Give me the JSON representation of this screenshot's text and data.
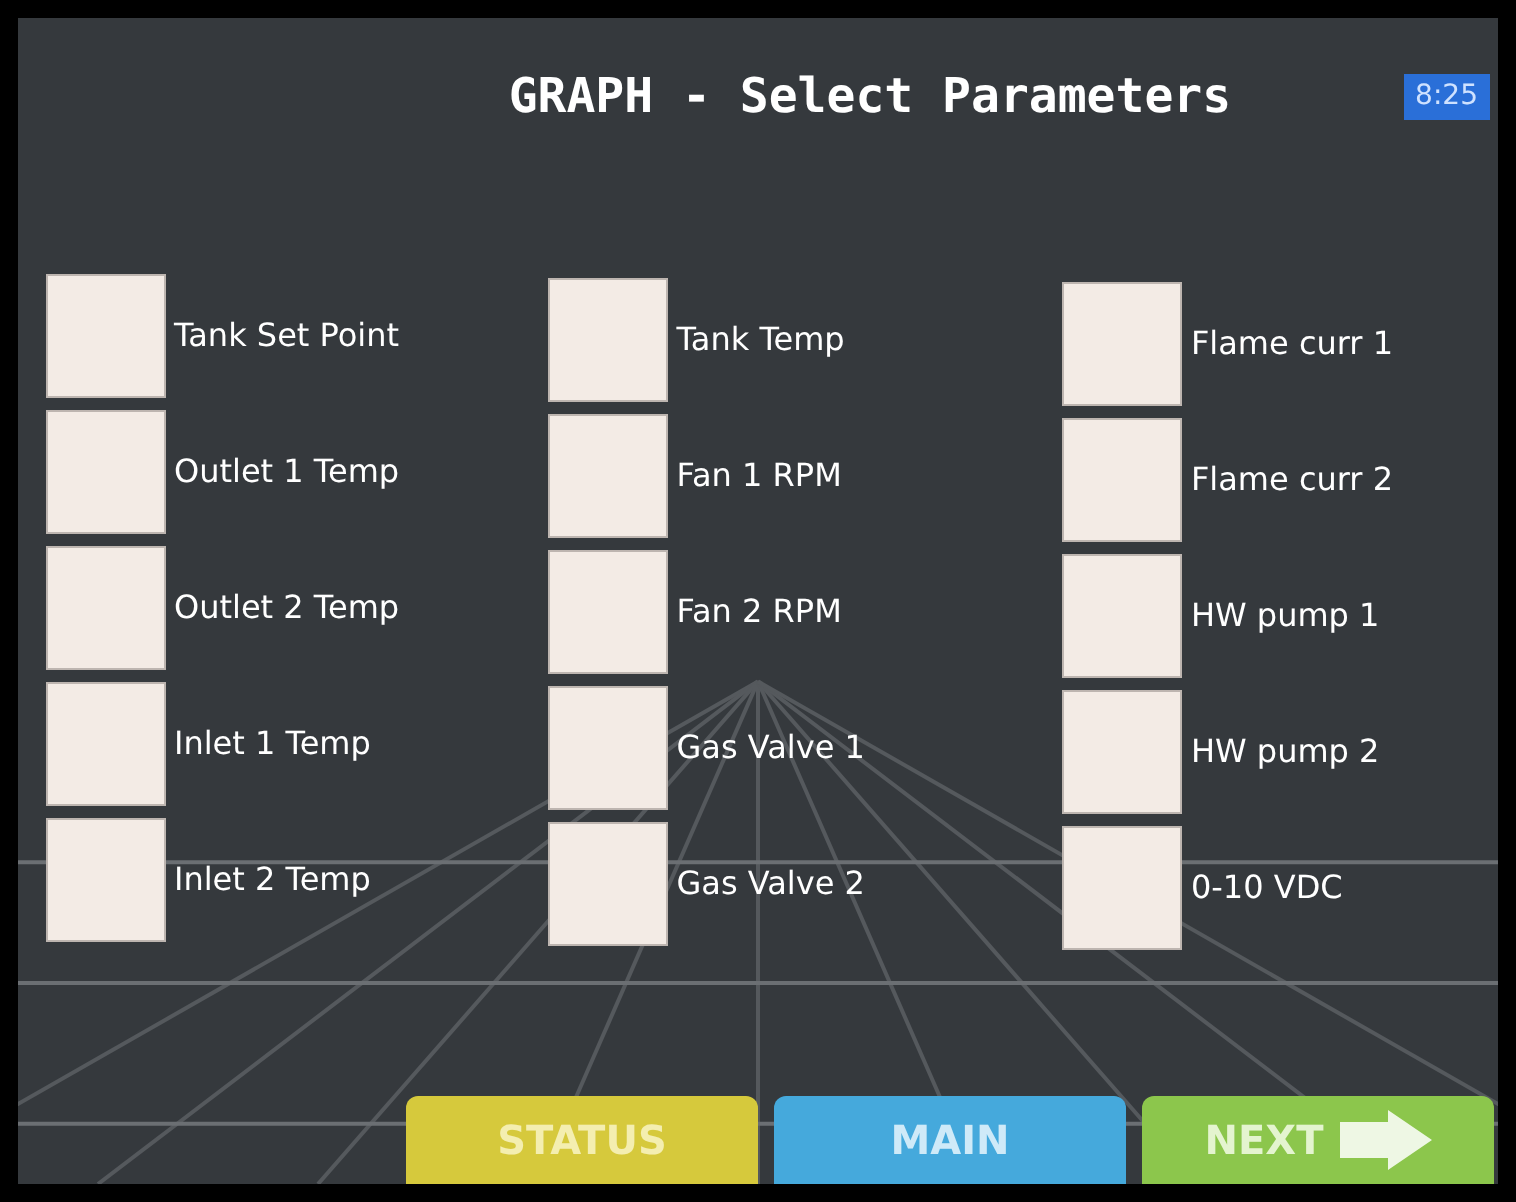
{
  "title": "GRAPH - Select Parameters",
  "time": "8:25",
  "columns": [
    {
      "items": [
        {
          "label": "Tank Set Point",
          "checked": false
        },
        {
          "label": "Outlet 1 Temp",
          "checked": false
        },
        {
          "label": "Outlet 2 Temp",
          "checked": false
        },
        {
          "label": "Inlet 1 Temp",
          "checked": false
        },
        {
          "label": "Inlet 2 Temp",
          "checked": false
        }
      ]
    },
    {
      "items": [
        {
          "label": "Tank Temp",
          "checked": false
        },
        {
          "label": "Fan 1 RPM",
          "checked": false
        },
        {
          "label": "Fan 2 RPM",
          "checked": false
        },
        {
          "label": "Gas Valve 1",
          "checked": false
        },
        {
          "label": "Gas Valve 2",
          "checked": false
        }
      ]
    },
    {
      "items": [
        {
          "label": "Flame curr 1",
          "checked": false
        },
        {
          "label": "Flame curr 2",
          "checked": false
        },
        {
          "label": "HW pump 1",
          "checked": false
        },
        {
          "label": "HW pump 2",
          "checked": false
        },
        {
          "label": "0-10 VDC",
          "checked": false
        }
      ]
    }
  ],
  "buttons": [
    {
      "label": "STATUS",
      "kind": "status"
    },
    {
      "label": "MAIN",
      "kind": "main"
    },
    {
      "label": "NEXT",
      "kind": "next"
    }
  ]
}
